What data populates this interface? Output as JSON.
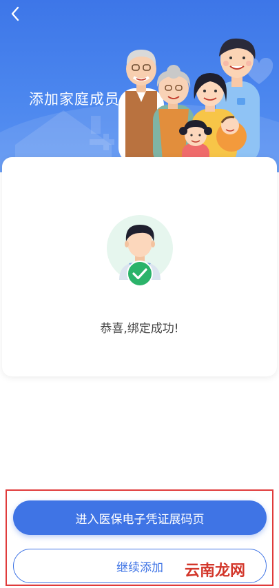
{
  "header": {
    "back_icon": "chevron-left-icon",
    "title": "添加家庭成员"
  },
  "card": {
    "avatar_icon": "person-avatar-icon",
    "check_icon": "check-icon",
    "message": "恭喜,绑定成功!"
  },
  "actions": {
    "primary_label": "进入医保电子凭证展码页",
    "secondary_label": "继续添加"
  },
  "watermark": "云南龙网",
  "colors": {
    "banner_blue": "#4b86ee",
    "accent_blue": "#3f74e5",
    "success_green": "#2bb36a",
    "highlight_red": "#e03b3b"
  }
}
